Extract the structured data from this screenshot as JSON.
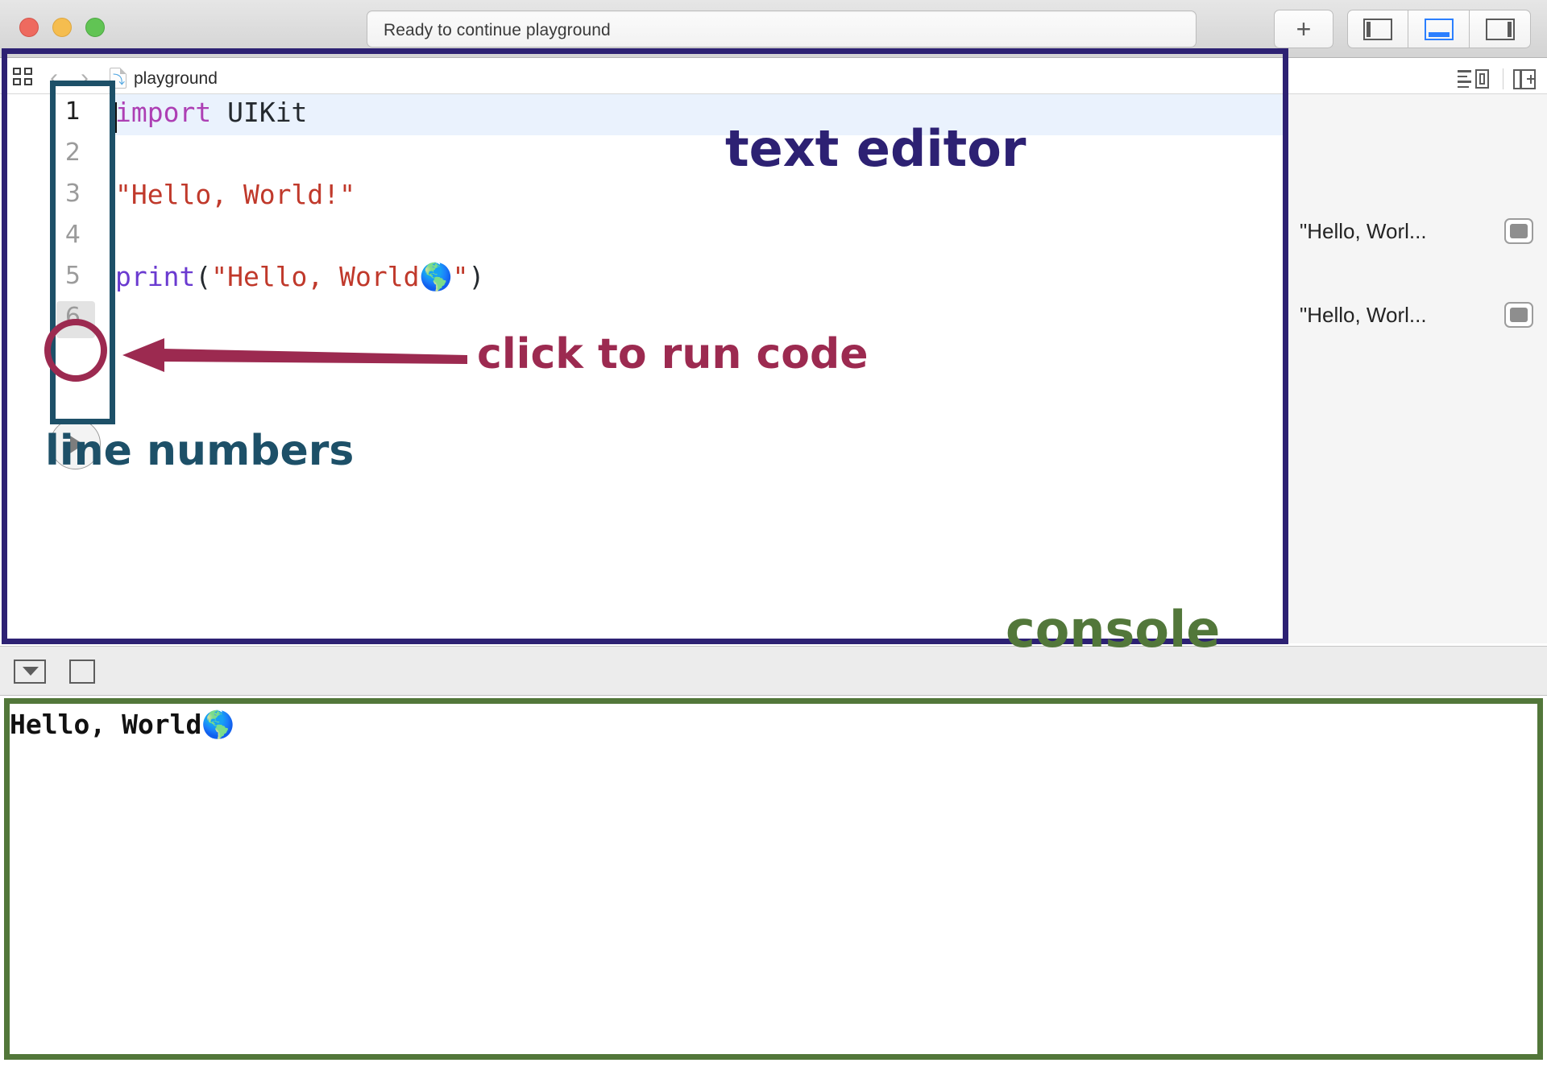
{
  "window": {
    "status_text": "Ready to continue playground",
    "traffic_lights": [
      "close-button",
      "minimize-button",
      "zoom-button"
    ],
    "toolbar": {
      "add_label": "+",
      "panes": [
        {
          "name": "navigator-pane-toggle",
          "active": false
        },
        {
          "name": "debug-pane-toggle",
          "active": true
        },
        {
          "name": "inspector-pane-toggle",
          "active": false
        }
      ]
    }
  },
  "tabbar": {
    "file_name": "playground",
    "back_glyph": "‹",
    "forward_glyph": "›",
    "swift_glyph": "⤵"
  },
  "editor": {
    "lines": [
      {
        "number": "1",
        "current": true,
        "segments": [
          {
            "text": "import",
            "cls": "k-import"
          },
          {
            "text": " UIKit",
            "cls": "k-plain"
          }
        ]
      },
      {
        "number": "2",
        "current": false,
        "segments": []
      },
      {
        "number": "3",
        "current": false,
        "segments": [
          {
            "text": "\"Hello, World!\"",
            "cls": "k-string"
          }
        ]
      },
      {
        "number": "4",
        "current": false,
        "segments": []
      },
      {
        "number": "5",
        "current": false,
        "segments": [
          {
            "text": "print",
            "cls": "k-fn"
          },
          {
            "text": "(",
            "cls": "k-plain"
          },
          {
            "text": "\"Hello, World🌎\"",
            "cls": "k-string"
          },
          {
            "text": ")",
            "cls": "k-plain"
          }
        ]
      },
      {
        "number": "6",
        "current": false,
        "chip": true,
        "segments": []
      }
    ],
    "run_button_label": "run-playground"
  },
  "results": {
    "rows": [
      {
        "value": "\"Hello, Worl...",
        "swatch": "quick-look-swatch"
      },
      {
        "value": "\"Hello, Worl...",
        "swatch": "quick-look-swatch"
      }
    ]
  },
  "console": {
    "output": "Hello, World🌎",
    "toolbar": [
      "filter-tray-icon",
      "clear-console-icon"
    ]
  },
  "annotations": {
    "text_editor": "text editor",
    "line_numbers": "line numbers",
    "click_to_run": "click to run code",
    "console": "console",
    "colors": {
      "editor_box": "#2d2173",
      "console_box": "#52773a",
      "gutter_box": "#1d5068",
      "run_circle": "#9c2a50"
    }
  }
}
